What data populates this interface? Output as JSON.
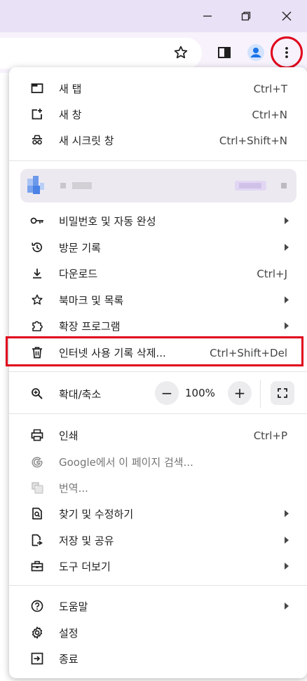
{
  "window": {
    "minimize_icon": "minimize-icon",
    "restore_icon": "restore-icon",
    "close_icon": "close-icon"
  },
  "toolbar": {
    "icons": [
      "star-icon",
      "side-panel-icon",
      "profile-icon",
      "kebab-menu-icon"
    ]
  },
  "menu": {
    "group1": [
      {
        "label": "새 탭",
        "shortcut": "Ctrl+T",
        "icon": "new-tab-icon"
      },
      {
        "label": "새 창",
        "shortcut": "Ctrl+N",
        "icon": "new-window-icon"
      },
      {
        "label": "새 시크릿 창",
        "shortcut": "Ctrl+Shift+N",
        "icon": "incognito-icon"
      }
    ],
    "group2": [
      {
        "label": "비밀번호 및 자동 완성",
        "icon": "key-icon",
        "submenu": true
      },
      {
        "label": "방문 기록",
        "icon": "history-icon",
        "submenu": true
      },
      {
        "label": "다운로드",
        "shortcut": "Ctrl+J",
        "icon": "download-icon"
      },
      {
        "label": "북마크 및 목록",
        "icon": "star-icon",
        "submenu": true
      },
      {
        "label": "확장 프로그램",
        "icon": "extension-icon",
        "submenu": true
      },
      {
        "label": "인터넷 사용 기록 삭제...",
        "shortcut": "Ctrl+Shift+Del",
        "icon": "trash-icon"
      }
    ],
    "zoom": {
      "label": "확대/축소",
      "value": "100%",
      "minus": "−",
      "plus": "+",
      "icon": "zoom-icon"
    },
    "group3": [
      {
        "label": "인쇄",
        "shortcut": "Ctrl+P",
        "icon": "print-icon"
      },
      {
        "label": "Google에서 이 페이지 검색...",
        "icon": "google-icon",
        "disabled": true
      },
      {
        "label": "번역...",
        "icon": "translate-icon",
        "disabled": true
      },
      {
        "label": "찾기 및 수정하기",
        "icon": "find-icon",
        "submenu": true
      },
      {
        "label": "저장 및 공유",
        "icon": "save-share-icon",
        "submenu": true
      },
      {
        "label": "도구 더보기",
        "icon": "toolbox-icon",
        "submenu": true
      }
    ],
    "group4": [
      {
        "label": "도움말",
        "icon": "help-icon",
        "submenu": true
      },
      {
        "label": "설정",
        "icon": "settings-icon"
      },
      {
        "label": "종료",
        "icon": "exit-icon"
      }
    ]
  },
  "colors": {
    "titlebar": "#e9e1f5",
    "toolbar": "#f7f2fc",
    "highlight": "#e0001a",
    "profile_bg": "#ece9f1",
    "avatar": "#1a73e8"
  }
}
